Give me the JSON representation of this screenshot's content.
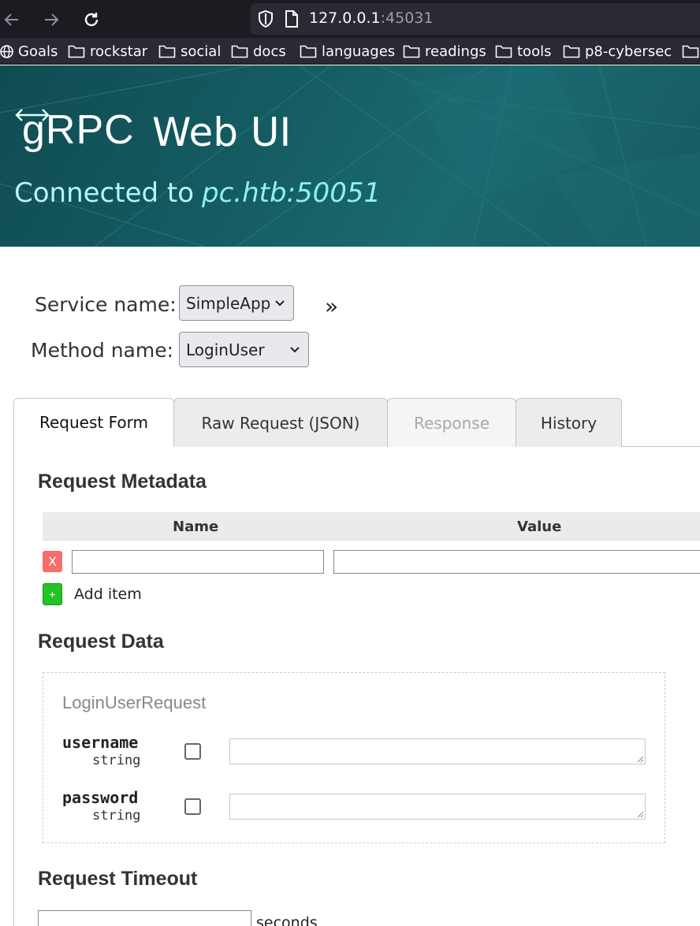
{
  "browser": {
    "url_host": "127.0.0.1",
    "url_port": ":45031",
    "bookmarks": [
      {
        "label": "Goals",
        "icon": "globe-icon"
      },
      {
        "label": "rockstar",
        "icon": "folder-icon"
      },
      {
        "label": "social",
        "icon": "folder-icon"
      },
      {
        "label": "docs",
        "icon": "folder-icon"
      },
      {
        "label": "languages",
        "icon": "folder-icon"
      },
      {
        "label": "readings",
        "icon": "folder-icon"
      },
      {
        "label": "tools",
        "icon": "folder-icon"
      },
      {
        "label": "p8-cybersec",
        "icon": "folder-icon"
      }
    ]
  },
  "header": {
    "brand_grpc": "gRPC",
    "brand_webui": "Web UI",
    "connected_prefix": "Connected to",
    "connected_host": "pc.htb:50051"
  },
  "selectors": {
    "service_label": "Service name:",
    "service_value": "SimpleApp",
    "method_label": "Method name:",
    "method_value": "LoginUser",
    "expand_glyph": "»"
  },
  "tabs": [
    {
      "label": "Request Form",
      "state": "active"
    },
    {
      "label": "Raw Request (JSON)",
      "state": "normal"
    },
    {
      "label": "Response",
      "state": "disabled"
    },
    {
      "label": "History",
      "state": "normal"
    }
  ],
  "metadata": {
    "title": "Request Metadata",
    "col_name": "Name",
    "col_value": "Value",
    "remove_label": "X",
    "add_glyph": "+",
    "add_label": "Add item"
  },
  "request_data": {
    "title": "Request Data",
    "message_name": "LoginUserRequest",
    "fields": [
      {
        "name": "username",
        "type": "string"
      },
      {
        "name": "password",
        "type": "string"
      }
    ]
  },
  "timeout": {
    "title": "Request Timeout",
    "unit": "seconds"
  },
  "colors": {
    "banner": "#155d63",
    "connected_text": "#b9f4f7",
    "remove_button": "#f86c6b",
    "add_button": "#22c322"
  }
}
